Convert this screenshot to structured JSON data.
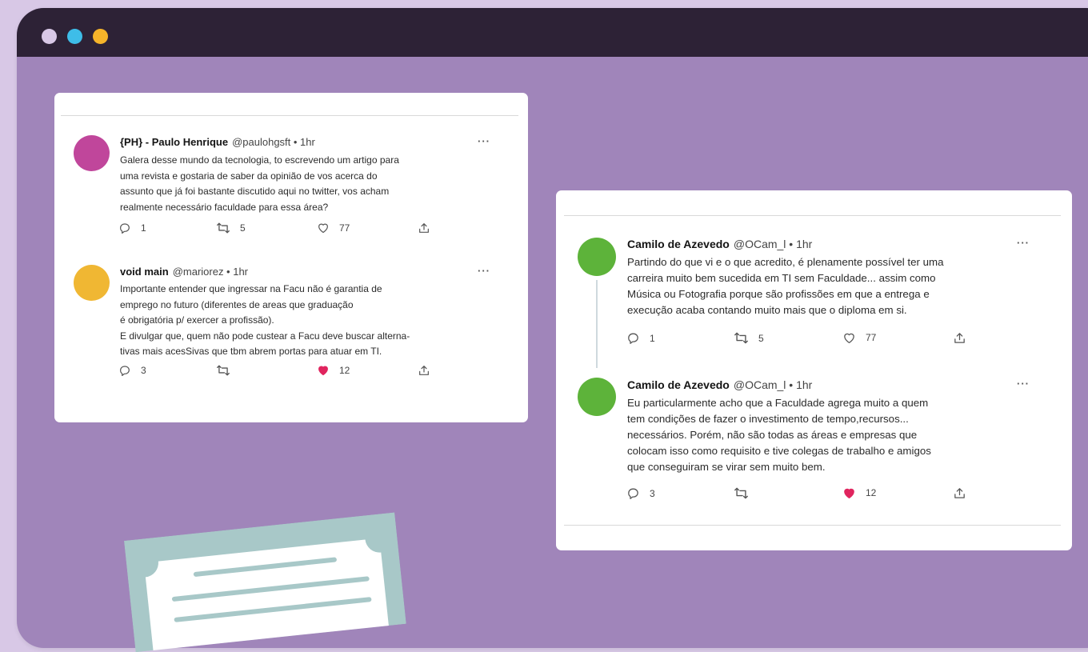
{
  "window": {
    "dots": [
      {
        "name": "window-dot-lavender",
        "color": "#d8c8e6"
      },
      {
        "name": "window-dot-blue",
        "color": "#3ebde8"
      },
      {
        "name": "window-dot-yellow",
        "color": "#f5b42a"
      }
    ],
    "background_color": "#a085ba",
    "titlebar_color": "#2d2236"
  },
  "card_left": {
    "tweets": [
      {
        "name": "{PH} - Paulo Henrique",
        "handle": "@paulohgsft • 1hr",
        "avatar_color": "#c0469b",
        "text": "Galera desse mundo da tecnologia, to escrevendo um artigo para\numa revista e gostaria de saber da opinião de vos acerca do\nassunto que já foi bastante discutido aqui no twitter, vos acham\nrealmente necessário faculdade para essa área?",
        "replies": "1",
        "retweets": "5",
        "likes": "77",
        "liked": false
      },
      {
        "name": "void main",
        "handle": "@mariorez • 1hr",
        "avatar_color": "#f0b733",
        "text": "Importante entender que ingressar na Facu não é garantia de\nemprego no futuro (diferentes de areas que graduação\né obrigatória p/ exercer a profissão).\nE divulgar que, quem não pode custear a Facu deve buscar alterna-\ntivas mais acesSivas que tbm abrem portas para atuar em TI.",
        "replies": "3",
        "retweets": "",
        "likes": "12",
        "liked": true
      }
    ]
  },
  "card_right": {
    "tweets": [
      {
        "name": "Camilo de Azevedo",
        "handle": "@OCam_l • 1hr",
        "avatar_color": "#5db33a",
        "text": "Partindo do que vi e o que acredito, é plenamente possível ter uma\ncarreira muito bem sucedida em TI sem Faculdade... assim como\nMúsica ou Fotografia porque são profissões em que a entrega e\nexecução acaba contando muito mais que o diploma em si.",
        "replies": "1",
        "retweets": "5",
        "likes": "77",
        "liked": false
      },
      {
        "name": "Camilo de Azevedo",
        "handle": "@OCam_l • 1hr",
        "avatar_color": "#5db33a",
        "text": "Eu particularmente acho que a Faculdade agrega muito a quem\ntem condições de fazer o investimento de tempo,recursos...\nnecessários. Porém, não são todas as áreas e empresas que\ncolocam isso como requisito e tive colegas de trabalho e amigos\nque conseguiram se virar sem muito bem.",
        "replies": "3",
        "retweets": "",
        "likes": "12",
        "liked": true
      }
    ]
  },
  "icons": {
    "reply": "reply-icon",
    "retweet": "retweet-icon",
    "like": "heart-icon",
    "share": "share-icon",
    "more": "more-icon"
  },
  "colors": {
    "like_active": "#e0245e",
    "certificate": "#a8c8c8"
  }
}
